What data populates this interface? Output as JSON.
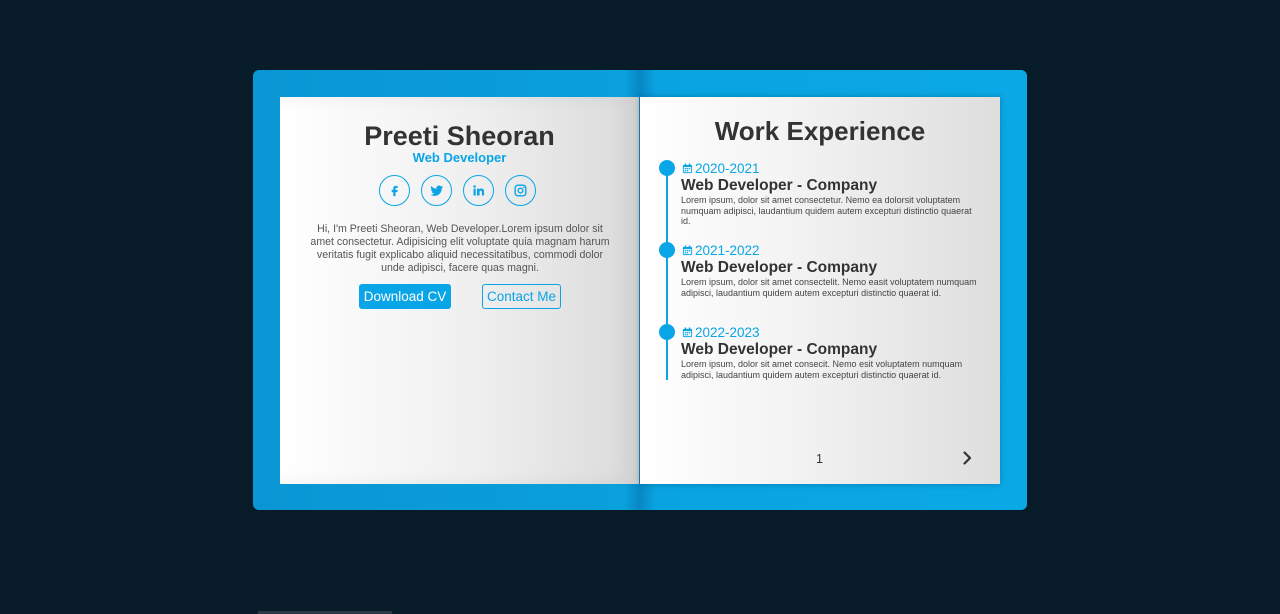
{
  "profile": {
    "name": "Preeti Sheoran",
    "role": "Web Developer",
    "socials": [
      "facebook-icon",
      "twitter-icon",
      "linkedin-icon",
      "instagram-icon"
    ],
    "bio": "Hi, I'm Preeti Sheoran, Web Developer.Lorem ipsum dolor sit amet consectetur. Adipisicing elit voluptate quia magnam harum veritatis fugit explicabo aliquid necessitatibus, commodi dolor unde adipisci, facere quas magni.",
    "buttons": {
      "download": "Download CV",
      "contact": "Contact Me"
    }
  },
  "experience": {
    "title": "Work Experience",
    "items": [
      {
        "date": "2020-2021",
        "title": "Web Developer - Company",
        "description": "Lorem ipsum, dolor sit amet consectetur. Nemo ea dolorsit voluptatem numquam adipisci, laudantium quidem autem excepturi distinctio quaerat id."
      },
      {
        "date": "2021-2022",
        "title": "Web Developer - Company",
        "description": "Lorem ipsum, dolor sit amet consectelit. Nemo easit voluptatem numquam adipisci, laudantium quidem autem excepturi distinctio quaerat id."
      },
      {
        "date": "2022-2023",
        "title": "Web Developer - Company",
        "description": "Lorem ipsum, dolor sit amet consecit. Nemo esit voluptatem numquam adipisci, laudantium quidem autem excepturi distinctio quaerat id."
      }
    ]
  },
  "pagination": {
    "page_number": "1",
    "next_icon": "chevron-right-icon"
  },
  "colors": {
    "background": "#081b29",
    "accent": "#0aa5e6",
    "text": "#333333"
  }
}
